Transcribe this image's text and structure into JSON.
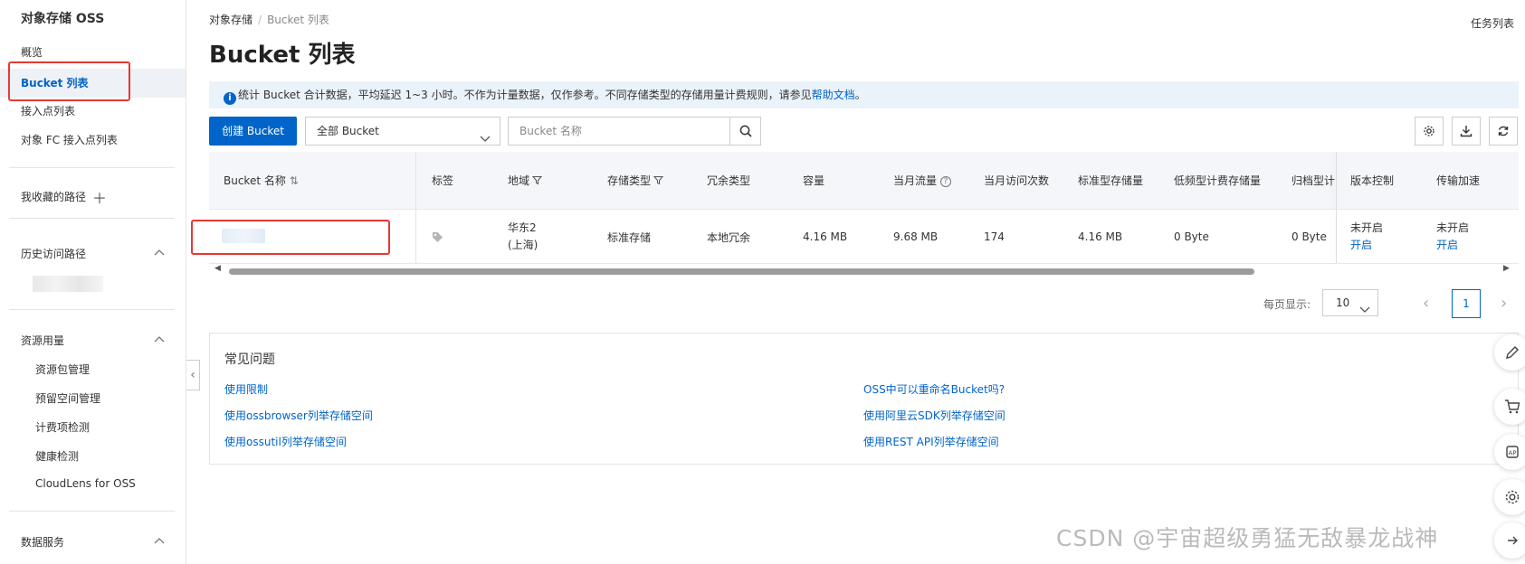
{
  "sidebar": {
    "title": "对象存储 OSS",
    "items": [
      "概览",
      "Bucket 列表",
      "接入点列表",
      "对象 FC 接入点列表"
    ],
    "favorites_label": "我收藏的路径",
    "history_label": "历史访问路径",
    "resource_label": "资源用量",
    "resource_items": [
      "资源包管理",
      "预留空间管理",
      "计费项检测",
      "健康检测",
      "CloudLens for OSS"
    ],
    "data_service_label": "数据服务"
  },
  "breadcrumb": {
    "root": "对象存储",
    "current": "Bucket 列表"
  },
  "task_list": "任务列表",
  "page_title": "Bucket 列表",
  "notice": {
    "text": "统计 Bucket 合计数据，平均延迟 1~3 小时。不作为计量数据，仅作参考。不同存储类型的存储用量计费规则，请参见",
    "link": "帮助文档",
    "suffix": "。"
  },
  "toolbar": {
    "create_label": "创建 Bucket",
    "filter_value": "全部 Bucket",
    "search_placeholder": "Bucket 名称"
  },
  "table": {
    "headers": {
      "name": "Bucket 名称",
      "tags": "标签",
      "region": "地域",
      "storage_class": "存储类型",
      "redundancy": "冗余类型",
      "capacity": "容量",
      "traffic": "当月流量",
      "visits": "当月访问次数",
      "standard": "标准型存储量",
      "ia": "低频型计费存储量",
      "archive": "归档型计",
      "versioning": "版本控制",
      "acceleration": "传输加速"
    },
    "rows": [
      {
        "region_line1": "华东2",
        "region_line2": "(上海)",
        "storage_class": "标准存储",
        "redundancy": "本地冗余",
        "capacity": "4.16 MB",
        "traffic": "9.68 MB",
        "visits": "174",
        "standard": "4.16 MB",
        "ia": "0 Byte",
        "archive": "0 Byte",
        "versioning_status": "未开启",
        "versioning_action": "开启",
        "acceleration_status": "未开启",
        "acceleration_action": "开启"
      }
    ]
  },
  "pagination": {
    "label": "每页显示:",
    "page_size": "10",
    "current_page": "1"
  },
  "faq": {
    "title": "常见问题",
    "links_left": [
      "使用限制",
      "使用ossbrowser列举存储空间",
      "使用ossutil列举存储空间"
    ],
    "links_right": [
      "OSS中可以重命名Bucket吗?",
      "使用阿里云SDK列举存储空间",
      "使用REST API列举存储空间"
    ]
  },
  "watermark": "CSDN @宇宙超级勇猛无敌暴龙战神",
  "colors": {
    "primary": "#0064c8",
    "highlight": "#e53935",
    "notice_bg": "#eaf2fa"
  }
}
